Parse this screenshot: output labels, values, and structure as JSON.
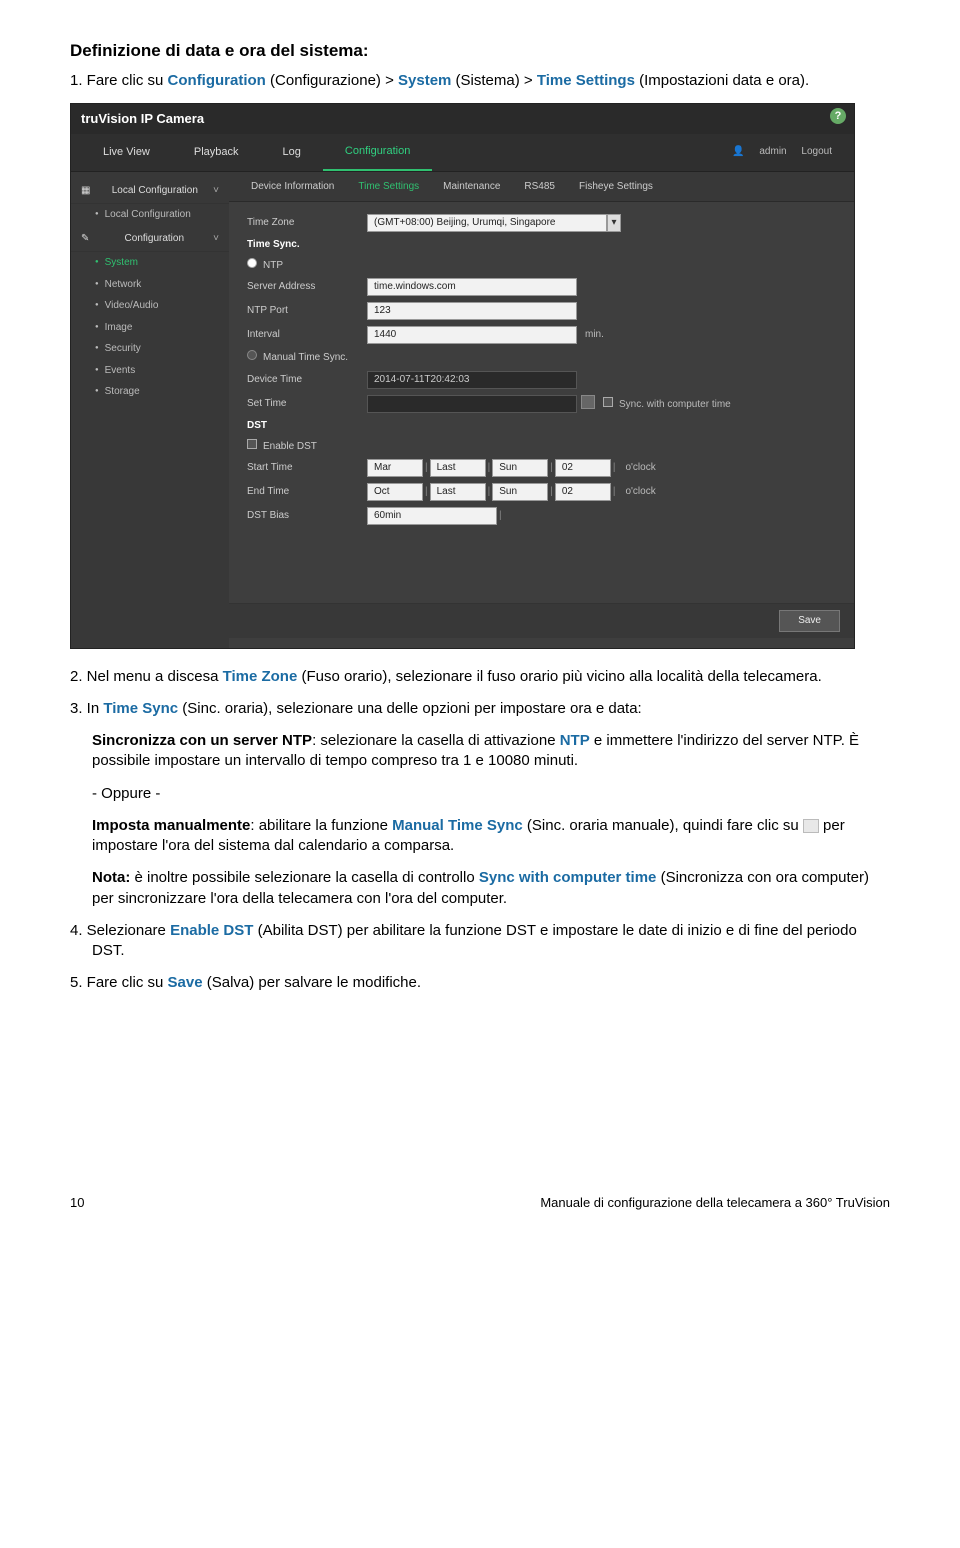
{
  "heading": "Definizione di data e ora del sistema:",
  "step1_prefix": "1. Fare clic su ",
  "step1_configuration": "Configuration",
  "step1_configuration_tr": " (Configurazione) > ",
  "step1_system": "System",
  "step1_system_tr": " (Sistema) > ",
  "step1_timesettings": "Time Settings",
  "step1_tail": " (Impostazioni data e ora).",
  "shot": {
    "brand": "truVision  IP Camera",
    "nav": {
      "live": "Live View",
      "playback": "Playback",
      "log": "Log",
      "config": "Configuration",
      "admin": "admin",
      "logout": "Logout"
    },
    "sidebar": {
      "local": "Local Configuration",
      "local_sub": "Local Configuration",
      "config": "Configuration",
      "system": "System",
      "network": "Network",
      "video": "Video/Audio",
      "image": "Image",
      "security": "Security",
      "events": "Events",
      "storage": "Storage"
    },
    "tabs": {
      "di": "Device Information",
      "ts": "Time Settings",
      "mnt": "Maintenance",
      "rs": "RS485",
      "fs": "Fisheye Settings"
    },
    "form": {
      "tz": "Time Zone",
      "tz_val": "(GMT+08:00) Beijing, Urumqi, Singapore",
      "sync": "Time Sync.",
      "ntp": "NTP",
      "server": "Server Address",
      "server_val": "time.windows.com",
      "port": "NTP Port",
      "port_val": "123",
      "interval": "Interval",
      "interval_val": "1440",
      "interval_unit": "min.",
      "manual": "Manual Time Sync.",
      "device": "Device Time",
      "device_val": "2014-07-11T20:42:03",
      "settime": "Set Time",
      "settime_chk": "Sync. with computer time",
      "dst": "DST",
      "enable_dst": "Enable DST",
      "start": "Start Time",
      "start_v": {
        "mon": "Mar",
        "wk": "Last",
        "day": "Sun",
        "hr": "02",
        "oclock": "o'clock"
      },
      "end": "End Time",
      "end_v": {
        "mon": "Oct",
        "wk": "Last",
        "day": "Sun",
        "hr": "02",
        "oclock": "o'clock"
      },
      "bias": "DST Bias",
      "bias_val": "60min",
      "save": "Save"
    }
  },
  "step2_prefix": "2. Nel menu a discesa ",
  "step2_tz": "Time Zone",
  "step2_tail": " (Fuso orario), selezionare il fuso orario più vicino alla località della telecamera.",
  "step3_prefix": "3. In ",
  "step3_ts": "Time Sync",
  "step3_tail": " (Sinc. oraria), selezionare una delle opzioni per impostare ora e data:",
  "ntp_bold": "Sincronizza con un server NTP",
  "ntp_text1": ": selezionare la casella di attivazione ",
  "ntp_label": "NTP",
  "ntp_text2": " e immettere l'indirizzo del server NTP. È possibile impostare un intervallo di tempo compreso tra 1 e 10080 minuti.",
  "oppure": "- Oppure -",
  "manual_bold": "Imposta manualmente",
  "manual_text1": ": abilitare la funzione ",
  "manual_label": "Manual Time Sync",
  "manual_text2": " (Sinc. oraria manuale), quindi fare clic su ",
  "manual_text3": " per impostare l'ora del sistema dal calendario a comparsa.",
  "nota_bold": "Nota:",
  "nota_text1": " è inoltre possibile selezionare la casella di controllo ",
  "nota_label": "Sync with computer time",
  "nota_text2": " (Sincronizza con ora computer) per sincronizzare l'ora della telecamera con l'ora del computer.",
  "step4_prefix": "4. Selezionare ",
  "step4_enable": "Enable DST",
  "step4_tail": " (Abilita DST) per abilitare la funzione DST e impostare le date di inizio e di fine del periodo DST.",
  "step5_prefix": "5. Fare clic su ",
  "step5_save": "Save",
  "step5_tail": " (Salva) per salvare le modifiche.",
  "footer_page": "10",
  "footer_title": "Manuale di configurazione della telecamera a 360° TruVision"
}
